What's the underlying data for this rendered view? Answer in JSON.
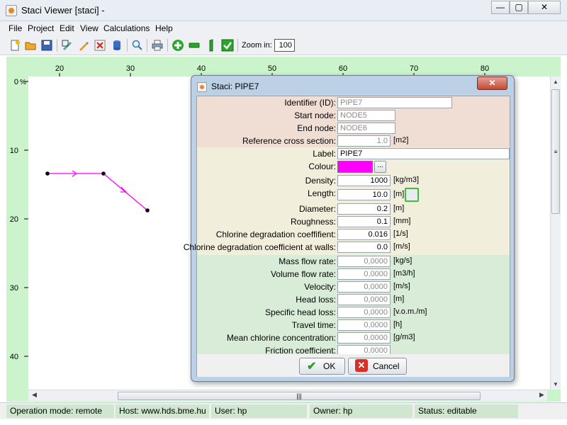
{
  "window": {
    "title": "Staci Viewer [staci]  -",
    "min_glyph": "—",
    "max_glyph": "▢",
    "close_glyph": "✕"
  },
  "menu": [
    "File",
    "Project",
    "Edit",
    "View",
    "Calculations",
    "Help"
  ],
  "toolbar": {
    "icons": [
      "new-file-icon",
      "open-folder-icon",
      "save-icon",
      "edit-icon",
      "pencil-icon",
      "delete-icon",
      "database-icon",
      "search-icon",
      "print-icon",
      "add-node-icon",
      "add-pipe-icon",
      "pressure-icon",
      "run-icon"
    ],
    "zoom_label": "Zoom in:",
    "zoom_value": "100"
  },
  "canvas": {
    "x_ticks": [
      "20",
      "30",
      "40",
      "50",
      "60",
      "70",
      "80"
    ],
    "y_ticks": [
      "0",
      "10",
      "20",
      "30",
      "40"
    ],
    "y_unit": "%",
    "pipe_colour": "#ff00ff"
  },
  "status": {
    "mode": "Operation mode: remote",
    "host": "Host: www.hds.bme.hu",
    "user": "User: hp",
    "owner": "Owner: hp",
    "state": "Status: editable"
  },
  "dialog": {
    "title": "Staci: PIPE7",
    "close_glyph": "✕",
    "identifiers": [
      {
        "label": "Identifier (ID):",
        "value": "PIPE7",
        "unit": ""
      },
      {
        "label": "Start node:",
        "value": "NODE5",
        "unit": ""
      },
      {
        "label": "End node:",
        "value": "NODE6",
        "unit": ""
      },
      {
        "label": "Reference cross section:",
        "value": "1.0",
        "unit": "[m2]"
      }
    ],
    "label": {
      "label": "Label:",
      "value": "PIPE7"
    },
    "colour": {
      "label": "Colour:",
      "button": "...",
      "hex": "#ff00ff"
    },
    "properties": [
      {
        "label": "Density:",
        "value": "1000",
        "unit": "[kg/m3]"
      },
      {
        "label": "Length:",
        "value": "10.0",
        "unit": "[m]"
      },
      {
        "label": "Diameter:",
        "value": "0.2",
        "unit": "[m]"
      },
      {
        "label": "Roughness:",
        "value": "0.1",
        "unit": "[mm]"
      },
      {
        "label": "Chlorine degradation coeffifient:",
        "value": "0.016",
        "unit": "[1/s]"
      },
      {
        "label": "Chlorine degradation coefficient at walls:",
        "value": "0.0",
        "unit": "[m/s]"
      }
    ],
    "results": [
      {
        "label": "Mass flow rate:",
        "value": "0,0000",
        "unit": "[kg/s]"
      },
      {
        "label": "Volume flow rate:",
        "value": "0,0000",
        "unit": "[m3/h]"
      },
      {
        "label": "Velocity:",
        "value": "0,0000",
        "unit": "[m/s]"
      },
      {
        "label": "Head loss:",
        "value": "0,0000",
        "unit": "[m]"
      },
      {
        "label": "Specific head loss:",
        "value": "0,0000",
        "unit": "[v.o.m./m]"
      },
      {
        "label": "Travel time:",
        "value": "0,0000",
        "unit": "[h]"
      },
      {
        "label": "Mean chlorine concentration:",
        "value": "0,0000",
        "unit": "[g/m3]"
      },
      {
        "label": "Friction coefficient:",
        "value": "0,0000",
        "unit": ""
      }
    ],
    "ok_label": "OK",
    "cancel_label": "Cancel"
  }
}
